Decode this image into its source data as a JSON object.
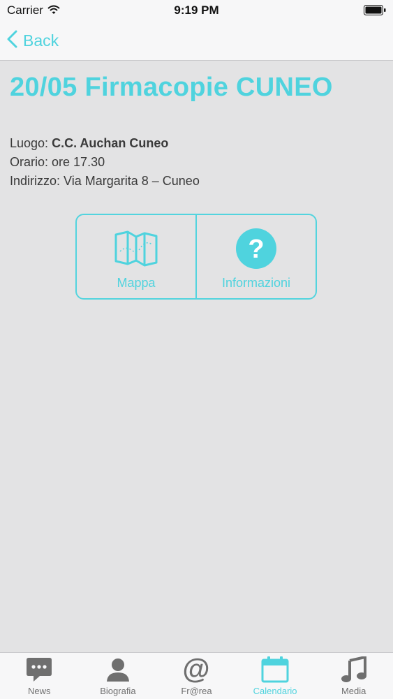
{
  "status_bar": {
    "carrier": "Carrier",
    "time": "9:19 PM"
  },
  "nav": {
    "back_label": "Back"
  },
  "event": {
    "title": "20/05 Firmacopie CUNEO",
    "place_label": "Luogo:",
    "place_value": "C.C. Auchan Cuneo",
    "time_label": "Orario:",
    "time_value": "ore 17.30",
    "address_label": "Indirizzo:",
    "address_value": "Via Margarita 8 – Cuneo"
  },
  "actions": [
    {
      "label": "Mappa",
      "icon": "map-icon"
    },
    {
      "label": "Informazioni",
      "icon": "question-icon"
    }
  ],
  "tabbar": {
    "active": "Calendario",
    "items": [
      {
        "label": "News",
        "icon": "chat-bubble-icon"
      },
      {
        "label": "Biografia",
        "icon": "person-icon"
      },
      {
        "label": "Fr@rea",
        "icon": "at-sign-icon"
      },
      {
        "label": "Calendario",
        "icon": "calendar-icon"
      },
      {
        "label": "Media",
        "icon": "music-note-icon"
      }
    ]
  },
  "colors": {
    "accent": "#4fd3de",
    "background": "#e3e3e4",
    "bar": "#f7f7f8",
    "tab_inactive": "#6f6f6f"
  }
}
